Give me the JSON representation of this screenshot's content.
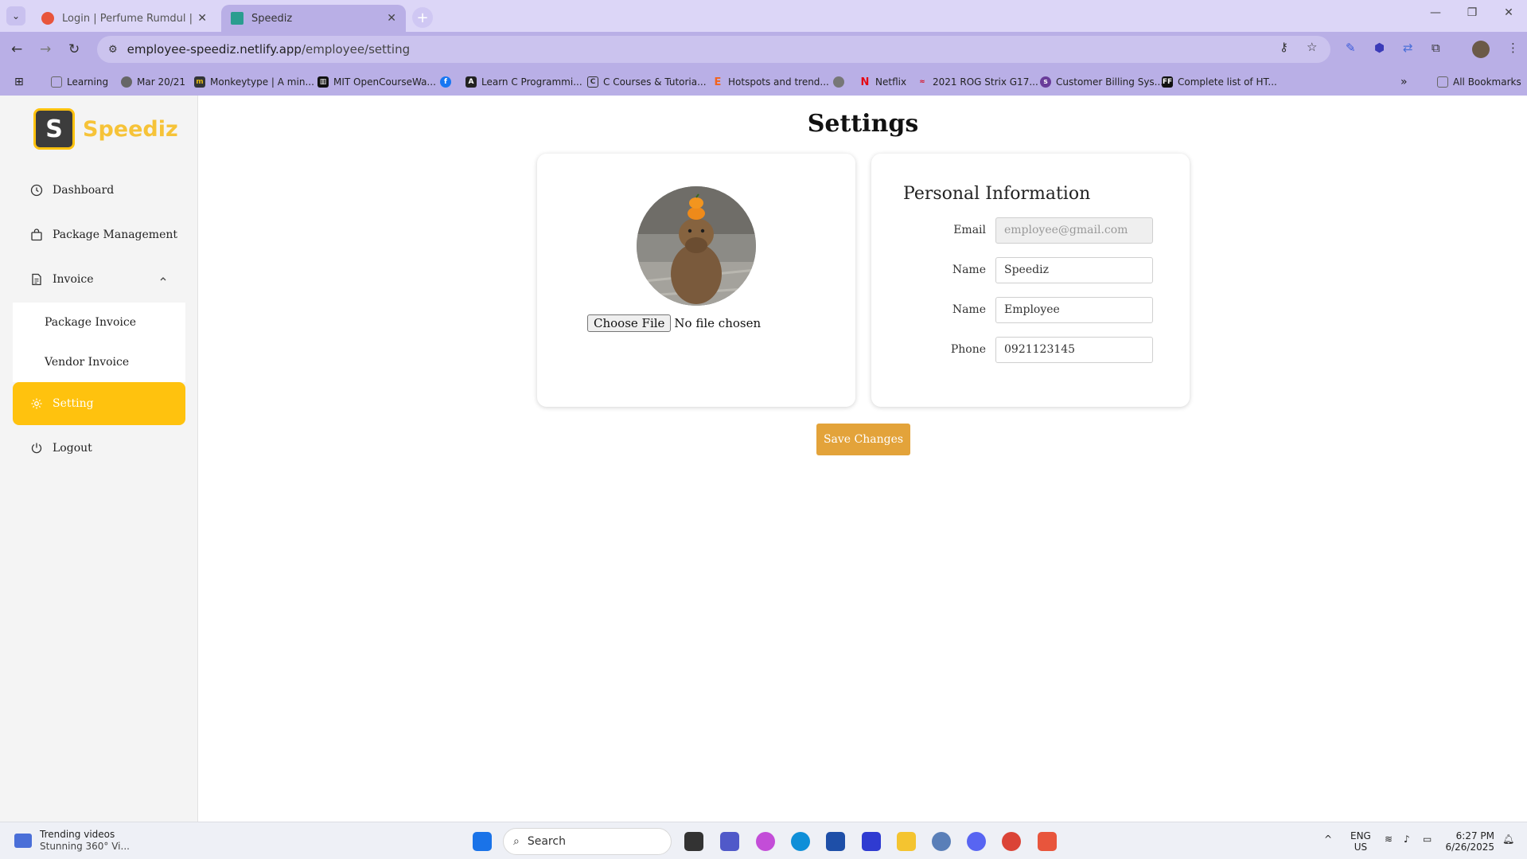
{
  "browser": {
    "tabs": [
      {
        "title": "Login | Perfume Rumdul | Postr",
        "favicon_color": "#e8553c",
        "active": false
      },
      {
        "title": "Speediz",
        "favicon_color": "#2a9d8f",
        "active": true
      }
    ],
    "new_tab_label": "+",
    "window_controls": {
      "minimize": "—",
      "restore": "❐",
      "close": "✕"
    },
    "url_host": "employee-speediz.netlify.app",
    "url_path": "/employee/setting",
    "bookmarks": [
      {
        "label": "Learning",
        "icon": "folder-icon",
        "color": "#666666"
      },
      {
        "label": "Mar 20/21",
        "icon": "globe-icon",
        "color": "#666666"
      },
      {
        "label": "Monkeytype | A min...",
        "icon": "monkeytype-icon",
        "color": "#323437"
      },
      {
        "label": "MIT OpenCourseWa...",
        "icon": "mit-icon",
        "color": "#111111"
      },
      {
        "label": "",
        "icon": "facebook-icon",
        "color": "#1877f2"
      },
      {
        "label": "Learn C Programmi...",
        "icon": "learn-c-icon",
        "color": "#222222"
      },
      {
        "label": "C Courses & Tutoria...",
        "icon": "c-courses-icon",
        "color": "#333333"
      },
      {
        "label": "Hotspots and trend...",
        "icon": "etsy-icon",
        "color": "#f1641e"
      },
      {
        "label": "",
        "icon": "globe-icon",
        "color": "#777777"
      },
      {
        "label": "Netflix",
        "icon": "netflix-icon",
        "color": "#e50914"
      },
      {
        "label": "2021 ROG Strix G17...",
        "icon": "rog-icon",
        "color": "#d7182a"
      },
      {
        "label": "Customer Billing Sys...",
        "icon": "billing-icon",
        "color": "#6a3d9a"
      },
      {
        "label": "Complete list of HT...",
        "icon": "ff-icon",
        "color": "#111111"
      }
    ],
    "bookmarks_overflow": "»",
    "all_bookmarks": "All Bookmarks"
  },
  "sidebar": {
    "brand_initial": "S",
    "brand_name": "Speediz",
    "items": [
      {
        "label": "Dashboard",
        "icon": "clock-icon"
      },
      {
        "label": "Package Management",
        "icon": "bag-icon"
      },
      {
        "label": "Invoice",
        "icon": "document-icon",
        "expanded": true
      },
      {
        "label": "Setting",
        "icon": "gear-icon",
        "active": true
      },
      {
        "label": "Logout",
        "icon": "power-icon"
      }
    ],
    "invoice_subitems": [
      {
        "label": "Package Invoice"
      },
      {
        "label": "Vendor Invoice"
      }
    ]
  },
  "page": {
    "title": "Settings",
    "file_button": "Choose File",
    "file_status": "No file chosen",
    "personal_info_title": "Personal Information",
    "fields": [
      {
        "label": "Email",
        "value": "employee@gmail.com",
        "disabled": true
      },
      {
        "label": "Name",
        "value": "Speediz",
        "disabled": false
      },
      {
        "label": "Name",
        "value": "Employee",
        "disabled": false
      },
      {
        "label": "Phone",
        "value": "0921123145",
        "disabled": false
      }
    ],
    "save_label": "Save Changes"
  },
  "colors": {
    "accent": "#ffc20e",
    "save_button": "#e3a33a",
    "brand_text": "#f6c338",
    "browser_frame": "#b9afe6"
  },
  "taskbar": {
    "widget_title": "Trending videos",
    "widget_sub": "Stunning 360° Vi...",
    "search_placeholder": "Search",
    "lang_top": "ENG",
    "lang_bottom": "US",
    "time": "6:27 PM",
    "date": "6/26/2025"
  }
}
